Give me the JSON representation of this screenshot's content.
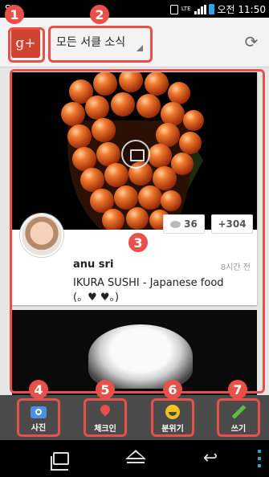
{
  "status_bar": {
    "carrier": "SI",
    "network": "LTE",
    "time": "오전 11:50"
  },
  "action_bar": {
    "logo_text": "g+",
    "stream_selector": "모든 서클 소식"
  },
  "post": {
    "comment_count": "36",
    "plus_count": "+304",
    "author": "anu sri",
    "time": "8시간 전",
    "text_line1": "IKURA SUSHI - Japanese food",
    "text_line2": "(。♥ ♥。)"
  },
  "bottom_tabs": [
    {
      "label": "사진",
      "icon": "camera-icon"
    },
    {
      "label": "체크인",
      "icon": "location-pin-icon"
    },
    {
      "label": "분위기",
      "icon": "smile-icon"
    },
    {
      "label": "쓰기",
      "icon": "pencil-icon"
    }
  ],
  "callouts": [
    "1",
    "2",
    "3",
    "4",
    "5",
    "6",
    "7"
  ],
  "colors": {
    "highlight": "#e8504a",
    "gplus": "#d2432f",
    "camera": "#4a90e2",
    "smile": "#f2c31b",
    "pencil": "#5bbd3f",
    "battery": "#2ba5e6"
  }
}
